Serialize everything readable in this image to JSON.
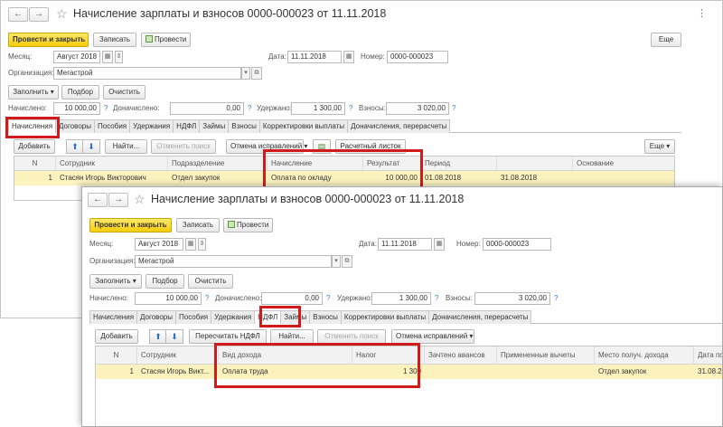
{
  "doc_title": "Начисление зарплаты и взносов 0000-000023 от 11.11.2018",
  "nav": {
    "back": "←",
    "forward": "→",
    "star": "☆"
  },
  "toolbar": {
    "post_close": "Провести и закрыть",
    "save": "Записать",
    "post": "Провести",
    "more": "Еще"
  },
  "header": {
    "month_label": "Месяц:",
    "month_value": "Август 2018",
    "date_label": "Дата:",
    "date_value": "11.11.2018",
    "number_label": "Номер:",
    "number_value": "0000-000023",
    "org_label": "Организация:",
    "org_value": "Мегастрой"
  },
  "actions": {
    "fill": "Заполнить",
    "select": "Подбор",
    "clear": "Очистить"
  },
  "totals": {
    "accrued_label": "Начислено:",
    "accrued_value": "10 000,00",
    "extra_label": "Доначислено:",
    "extra_value": "0,00",
    "withheld_label": "Удержано:",
    "withheld_value": "1 300,00",
    "contrib_label": "Взносы:",
    "contrib_value": "3 020,00",
    "help": "?"
  },
  "tabs1": [
    "Начисления",
    "Договоры",
    "Пособия",
    "Удержания",
    "НДФЛ",
    "Займы",
    "Взносы",
    "Корректировки выплаты",
    "Доначисления, перерасчеты"
  ],
  "tabs2": [
    "Начисления",
    "Договоры",
    "Пособия",
    "Удержания",
    "НДФЛ",
    "Займы",
    "Взносы",
    "Корректировки выплаты",
    "Доначисления, перерасчеты"
  ],
  "table_toolbar1": {
    "add": "Добавить",
    "find": "Найти...",
    "cancel_search": "Отменить поиск",
    "cancel_fix": "Отмена исправлений",
    "payslip": "Расчетный листок",
    "more": "Еще"
  },
  "table_toolbar2": {
    "add": "Добавить",
    "recalc": "Пересчитать НДФЛ",
    "find": "Найти...",
    "cancel_search": "Отменить поиск",
    "cancel_fix": "Отмена исправлений"
  },
  "grid1": {
    "columns": [
      "N",
      "Сотрудник",
      "Подразделение",
      "Начисление",
      "Результат",
      "Период",
      "",
      "Основание"
    ],
    "row": [
      "1",
      "Стасян Игорь Викторович",
      "Отдел закупок",
      "Оплата по окладу",
      "10 000,00",
      "01.08.2018",
      "31.08.2018",
      ""
    ]
  },
  "grid2": {
    "columns": [
      "N",
      "Сотрудник",
      "Вид дохода",
      "Налог",
      "Зачтено авансов",
      "Примененные вычеты",
      "Место получ. дохода",
      "Дата по"
    ],
    "row": [
      "1",
      "Стасян Игорь Викт...",
      "Оплата труда",
      "1 300",
      "",
      "",
      "Отдел закупок",
      "31.08.20"
    ]
  },
  "colors": {
    "highlight": "#d11b1b",
    "primary": "#f6cc0a",
    "row": "#fbf2bd"
  }
}
